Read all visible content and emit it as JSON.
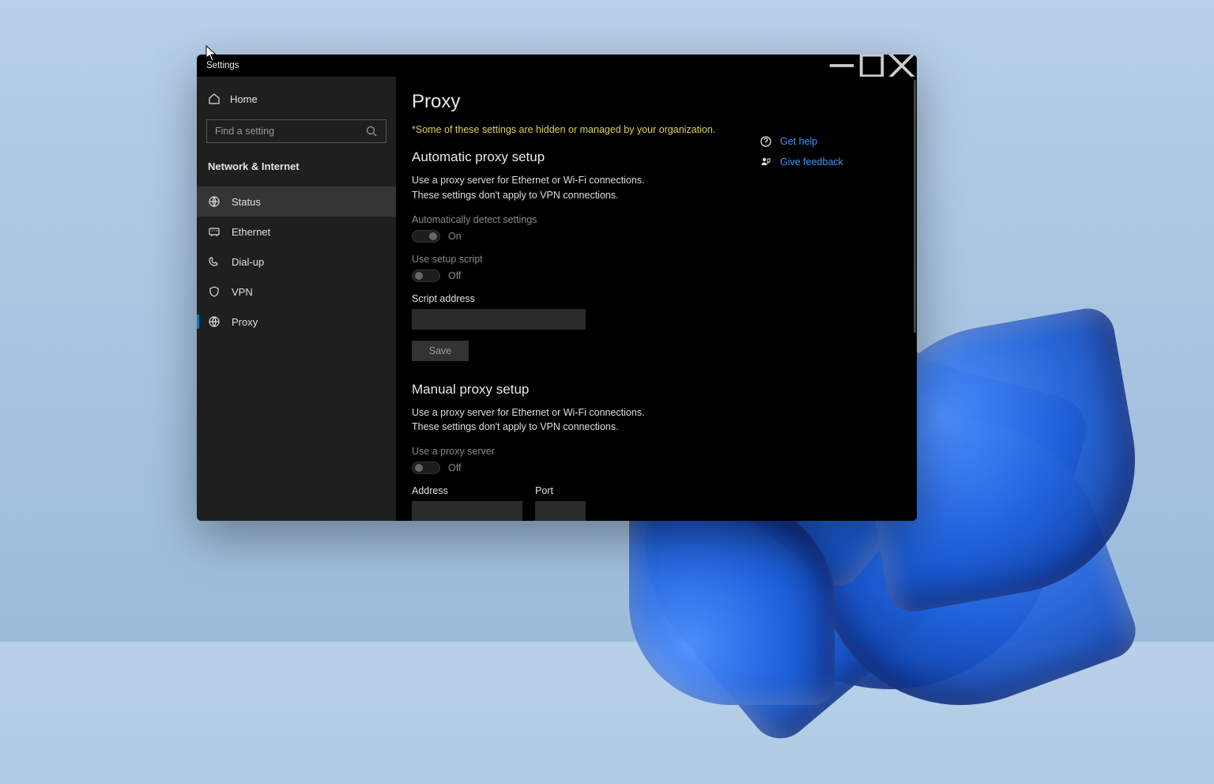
{
  "window": {
    "title": "Settings"
  },
  "sidebar": {
    "home_label": "Home",
    "search_placeholder": "Find a setting",
    "section": "Network & Internet",
    "items": [
      {
        "label": "Status",
        "icon": "status"
      },
      {
        "label": "Ethernet",
        "icon": "ethernet"
      },
      {
        "label": "Dial-up",
        "icon": "dialup"
      },
      {
        "label": "VPN",
        "icon": "vpn"
      },
      {
        "label": "Proxy",
        "icon": "proxy"
      }
    ]
  },
  "page": {
    "title": "Proxy",
    "warning": "*Some of these settings are hidden or managed by your organization.",
    "auto": {
      "heading": "Automatic proxy setup",
      "desc": "Use a proxy server for Ethernet or Wi-Fi connections. These settings don't apply to VPN connections.",
      "detect_label": "Automatically detect settings",
      "detect_state": "On",
      "script_label": "Use setup script",
      "script_state": "Off",
      "addr_label": "Script address",
      "addr_value": "",
      "save": "Save"
    },
    "manual": {
      "heading": "Manual proxy setup",
      "desc": "Use a proxy server for Ethernet or Wi-Fi connections. These settings don't apply to VPN connections.",
      "use_label": "Use a proxy server",
      "use_state": "Off",
      "addr_label": "Address",
      "port_label": "Port"
    }
  },
  "aside": {
    "help": "Get help",
    "feedback": "Give feedback"
  }
}
